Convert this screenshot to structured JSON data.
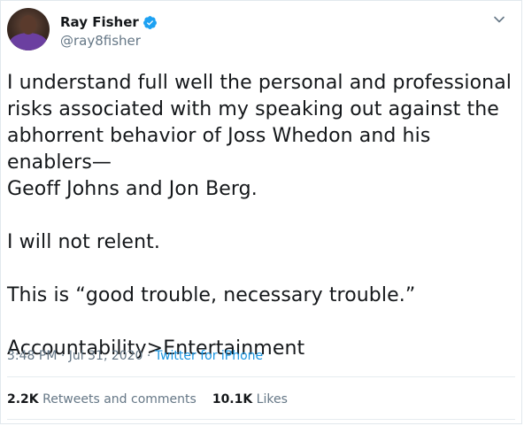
{
  "user": {
    "display_name": "Ray Fisher",
    "handle": "@ray8fisher",
    "verified_icon": "verified-badge-icon"
  },
  "tweet": {
    "text": "I understand full well the personal and professional\nrisks associated with my speaking out against the\nabhorrent behavior of Joss Whedon and his enablers—\nGeoff Johns and Jon Berg.\n\nI will not relent.\n\nThis is “good trouble, necessary trouble.”\n\nAccountability>Entertainment",
    "time": "3:48 PM",
    "separator": " · ",
    "date": "Jul 31, 2020",
    "source": "Twitter for iPhone"
  },
  "stats": {
    "retweets_count": "2.2K",
    "retweets_label": " Retweets and comments",
    "likes_count": "10.1K",
    "likes_label": " Likes"
  },
  "colors": {
    "link": "#1b95e0",
    "verified": "#1da1f2",
    "muted": "#657786"
  }
}
